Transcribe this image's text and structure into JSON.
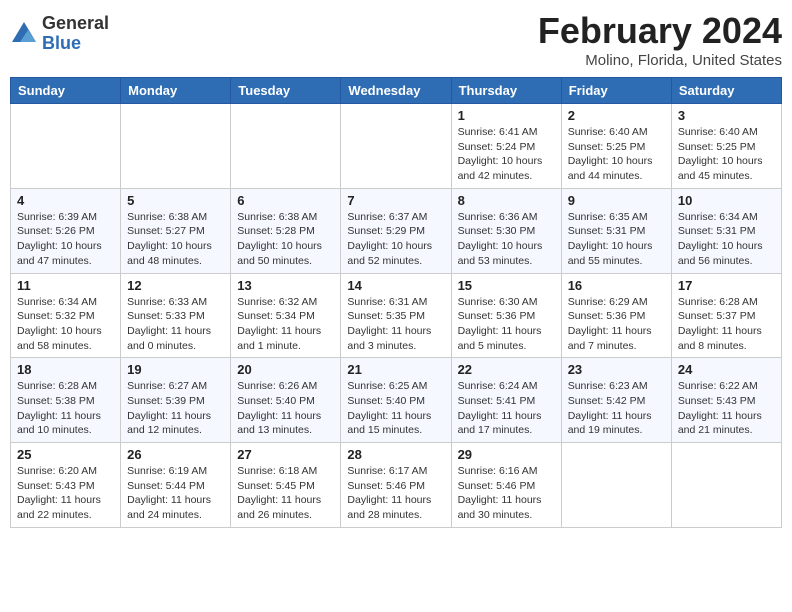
{
  "logo": {
    "general": "General",
    "blue": "Blue"
  },
  "header": {
    "title": "February 2024",
    "subtitle": "Molino, Florida, United States"
  },
  "days_of_week": [
    "Sunday",
    "Monday",
    "Tuesday",
    "Wednesday",
    "Thursday",
    "Friday",
    "Saturday"
  ],
  "weeks": [
    [
      {
        "day": "",
        "info": ""
      },
      {
        "day": "",
        "info": ""
      },
      {
        "day": "",
        "info": ""
      },
      {
        "day": "",
        "info": ""
      },
      {
        "day": "1",
        "info": "Sunrise: 6:41 AM\nSunset: 5:24 PM\nDaylight: 10 hours\nand 42 minutes."
      },
      {
        "day": "2",
        "info": "Sunrise: 6:40 AM\nSunset: 5:25 PM\nDaylight: 10 hours\nand 44 minutes."
      },
      {
        "day": "3",
        "info": "Sunrise: 6:40 AM\nSunset: 5:25 PM\nDaylight: 10 hours\nand 45 minutes."
      }
    ],
    [
      {
        "day": "4",
        "info": "Sunrise: 6:39 AM\nSunset: 5:26 PM\nDaylight: 10 hours\nand 47 minutes."
      },
      {
        "day": "5",
        "info": "Sunrise: 6:38 AM\nSunset: 5:27 PM\nDaylight: 10 hours\nand 48 minutes."
      },
      {
        "day": "6",
        "info": "Sunrise: 6:38 AM\nSunset: 5:28 PM\nDaylight: 10 hours\nand 50 minutes."
      },
      {
        "day": "7",
        "info": "Sunrise: 6:37 AM\nSunset: 5:29 PM\nDaylight: 10 hours\nand 52 minutes."
      },
      {
        "day": "8",
        "info": "Sunrise: 6:36 AM\nSunset: 5:30 PM\nDaylight: 10 hours\nand 53 minutes."
      },
      {
        "day": "9",
        "info": "Sunrise: 6:35 AM\nSunset: 5:31 PM\nDaylight: 10 hours\nand 55 minutes."
      },
      {
        "day": "10",
        "info": "Sunrise: 6:34 AM\nSunset: 5:31 PM\nDaylight: 10 hours\nand 56 minutes."
      }
    ],
    [
      {
        "day": "11",
        "info": "Sunrise: 6:34 AM\nSunset: 5:32 PM\nDaylight: 10 hours\nand 58 minutes."
      },
      {
        "day": "12",
        "info": "Sunrise: 6:33 AM\nSunset: 5:33 PM\nDaylight: 11 hours\nand 0 minutes."
      },
      {
        "day": "13",
        "info": "Sunrise: 6:32 AM\nSunset: 5:34 PM\nDaylight: 11 hours\nand 1 minute."
      },
      {
        "day": "14",
        "info": "Sunrise: 6:31 AM\nSunset: 5:35 PM\nDaylight: 11 hours\nand 3 minutes."
      },
      {
        "day": "15",
        "info": "Sunrise: 6:30 AM\nSunset: 5:36 PM\nDaylight: 11 hours\nand 5 minutes."
      },
      {
        "day": "16",
        "info": "Sunrise: 6:29 AM\nSunset: 5:36 PM\nDaylight: 11 hours\nand 7 minutes."
      },
      {
        "day": "17",
        "info": "Sunrise: 6:28 AM\nSunset: 5:37 PM\nDaylight: 11 hours\nand 8 minutes."
      }
    ],
    [
      {
        "day": "18",
        "info": "Sunrise: 6:28 AM\nSunset: 5:38 PM\nDaylight: 11 hours\nand 10 minutes."
      },
      {
        "day": "19",
        "info": "Sunrise: 6:27 AM\nSunset: 5:39 PM\nDaylight: 11 hours\nand 12 minutes."
      },
      {
        "day": "20",
        "info": "Sunrise: 6:26 AM\nSunset: 5:40 PM\nDaylight: 11 hours\nand 13 minutes."
      },
      {
        "day": "21",
        "info": "Sunrise: 6:25 AM\nSunset: 5:40 PM\nDaylight: 11 hours\nand 15 minutes."
      },
      {
        "day": "22",
        "info": "Sunrise: 6:24 AM\nSunset: 5:41 PM\nDaylight: 11 hours\nand 17 minutes."
      },
      {
        "day": "23",
        "info": "Sunrise: 6:23 AM\nSunset: 5:42 PM\nDaylight: 11 hours\nand 19 minutes."
      },
      {
        "day": "24",
        "info": "Sunrise: 6:22 AM\nSunset: 5:43 PM\nDaylight: 11 hours\nand 21 minutes."
      }
    ],
    [
      {
        "day": "25",
        "info": "Sunrise: 6:20 AM\nSunset: 5:43 PM\nDaylight: 11 hours\nand 22 minutes."
      },
      {
        "day": "26",
        "info": "Sunrise: 6:19 AM\nSunset: 5:44 PM\nDaylight: 11 hours\nand 24 minutes."
      },
      {
        "day": "27",
        "info": "Sunrise: 6:18 AM\nSunset: 5:45 PM\nDaylight: 11 hours\nand 26 minutes."
      },
      {
        "day": "28",
        "info": "Sunrise: 6:17 AM\nSunset: 5:46 PM\nDaylight: 11 hours\nand 28 minutes."
      },
      {
        "day": "29",
        "info": "Sunrise: 6:16 AM\nSunset: 5:46 PM\nDaylight: 11 hours\nand 30 minutes."
      },
      {
        "day": "",
        "info": ""
      },
      {
        "day": "",
        "info": ""
      }
    ]
  ]
}
